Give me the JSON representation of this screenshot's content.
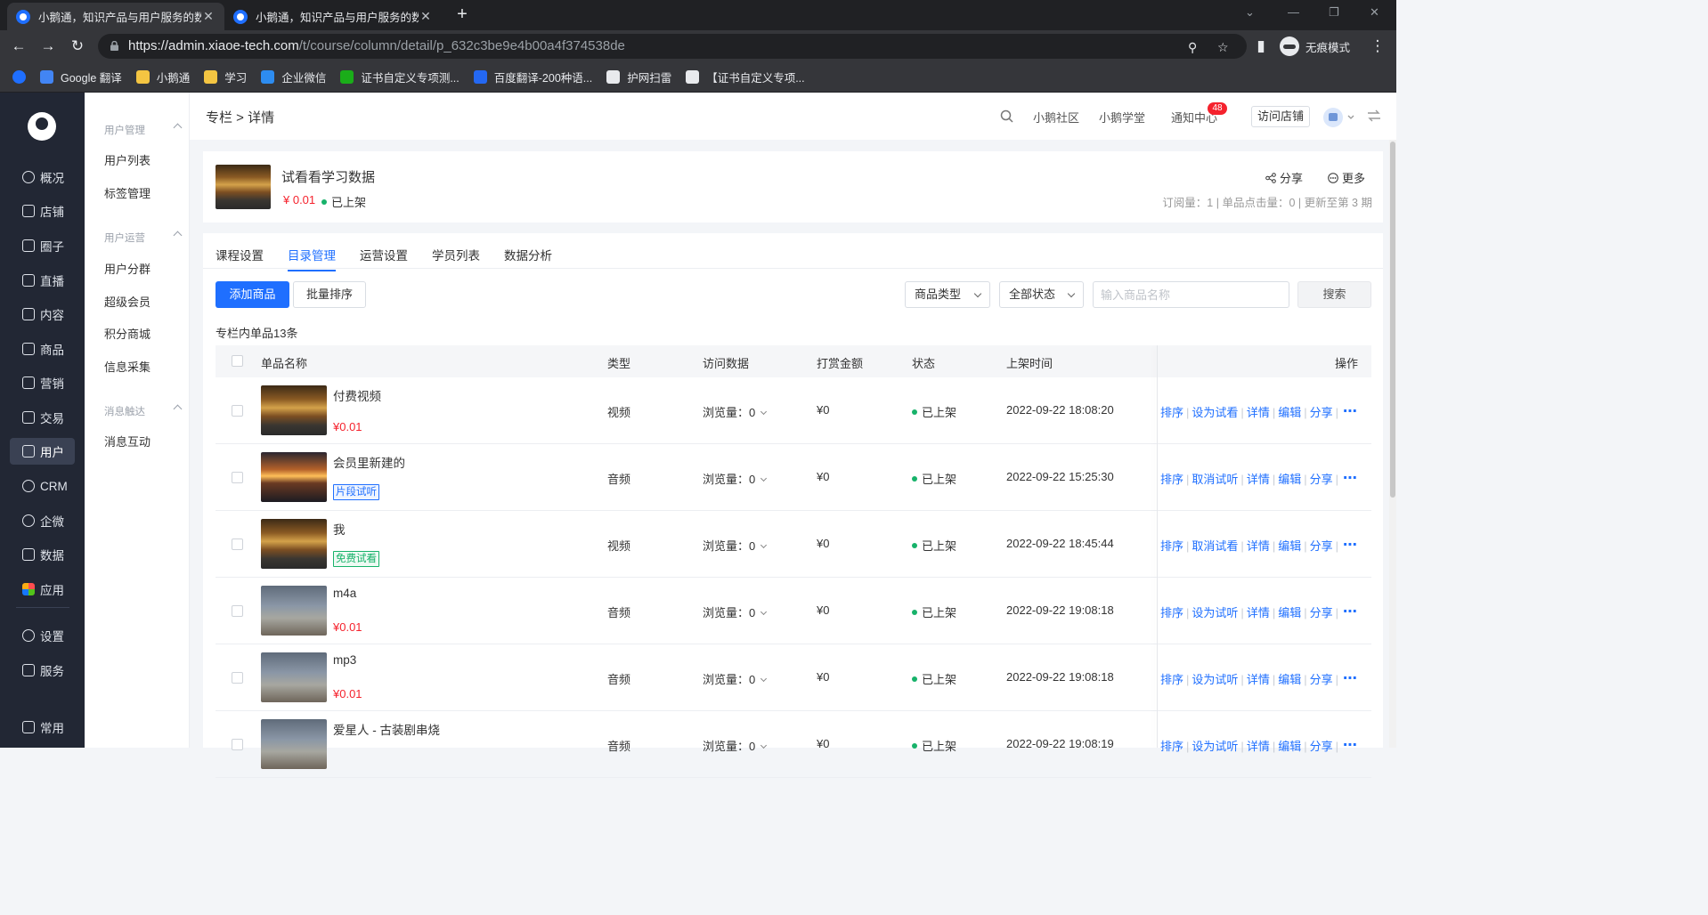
{
  "browser": {
    "tabs": [
      {
        "title": "小鹅通，知识产品与用户服务的数"
      },
      {
        "title": "小鹅通，知识产品与用户服务的数"
      }
    ],
    "url_host": "https://admin.xiaoe-tech.com",
    "url_path": "/t/course/column/detail/p_632c3be9e4b00a4f374538de",
    "incognito_label": "无痕模式",
    "bookmarks": [
      {
        "label": "Google 翻译",
        "color": "#4285f4"
      },
      {
        "label": "小鹅通",
        "color": "#f4c542"
      },
      {
        "label": "学习",
        "color": "#f4c542"
      },
      {
        "label": "企业微信",
        "color": "#2d8cf0"
      },
      {
        "label": "证书自定义专项测...",
        "color": "#1aad19"
      },
      {
        "label": "百度翻译-200种语...",
        "color": "#2468f2"
      },
      {
        "label": "护网扫雷",
        "color": "#e8eaed"
      },
      {
        "label": "【证书自定义专项...",
        "color": "#e8eaed"
      }
    ]
  },
  "nav": {
    "items": [
      {
        "label": "概况"
      },
      {
        "label": "店铺"
      },
      {
        "label": "圈子"
      },
      {
        "label": "直播"
      },
      {
        "label": "内容"
      },
      {
        "label": "商品"
      },
      {
        "label": "营销"
      },
      {
        "label": "交易"
      },
      {
        "label": "用户"
      },
      {
        "label": "CRM"
      },
      {
        "label": "企微"
      },
      {
        "label": "数据"
      },
      {
        "label": "应用"
      },
      {
        "label": "设置"
      },
      {
        "label": "服务"
      },
      {
        "label": "常用"
      }
    ],
    "active": "用户"
  },
  "subnav": {
    "sections": [
      {
        "heading": "用户管理",
        "items": [
          "用户列表",
          "标签管理"
        ]
      },
      {
        "heading": "用户运营",
        "items": [
          "用户分群",
          "超级会员",
          "积分商城",
          "信息采集"
        ]
      },
      {
        "heading": "消息触达",
        "items": [
          "消息互动"
        ]
      }
    ]
  },
  "header": {
    "breadcrumb": "专栏 > 详情",
    "links": [
      "小鹅社区",
      "小鹅学堂",
      "通知中心"
    ],
    "notify_count": "48",
    "visit_store": "访问店铺"
  },
  "column": {
    "title": "试看看学习数据",
    "price": "¥ 0.01",
    "status": "已上架",
    "share": "分享",
    "more": "更多",
    "stats": "订阅量：1  |  单品点击量：0  |  更新至第 3 期"
  },
  "tabs": [
    "课程设置",
    "目录管理",
    "运营设置",
    "学员列表",
    "数据分析"
  ],
  "active_tab": "目录管理",
  "toolbar": {
    "add": "添加商品",
    "batch_sort": "批量排序",
    "type_select": "商品类型",
    "status_select": "全部状态",
    "search_placeholder": "输入商品名称",
    "search": "搜索"
  },
  "count_text": "专栏内单品13条",
  "table": {
    "headers": [
      "单品名称",
      "类型",
      "访问数据",
      "打赏金额",
      "状态",
      "上架时间",
      "操作"
    ],
    "rows": [
      {
        "name": "付费视频",
        "thumb": "autumn",
        "price": "¥0.01",
        "tag": "",
        "tag_color": "",
        "type": "视频",
        "views": "浏览量：0",
        "reward": "¥0",
        "status": "已上架",
        "time": "2022-09-22 18:08:20",
        "trial": "设为试看"
      },
      {
        "name": "会员里新建的",
        "thumb": "sunset",
        "price": "",
        "tag": "片段试听",
        "tag_color": "blue",
        "type": "音频",
        "views": "浏览量：0",
        "reward": "¥0",
        "status": "已上架",
        "time": "2022-09-22 15:25:30",
        "trial": "取消试听"
      },
      {
        "name": "我",
        "thumb": "autumn",
        "price": "",
        "tag": "免费试看",
        "tag_color": "green",
        "type": "视频",
        "views": "浏览量：0",
        "reward": "¥0",
        "status": "已上架",
        "time": "2022-09-22 18:45:44",
        "trial": "取消试看"
      },
      {
        "name": "m4a",
        "thumb": "deer",
        "price": "¥0.01",
        "tag": "",
        "tag_color": "",
        "type": "音频",
        "views": "浏览量：0",
        "reward": "¥0",
        "status": "已上架",
        "time": "2022-09-22 19:08:18",
        "trial": "设为试听"
      },
      {
        "name": "mp3",
        "thumb": "deer",
        "price": "¥0.01",
        "tag": "",
        "tag_color": "",
        "type": "音频",
        "views": "浏览量：0",
        "reward": "¥0",
        "status": "已上架",
        "time": "2022-09-22 19:08:18",
        "trial": "设为试听"
      },
      {
        "name": "爱星人 - 古装剧串烧",
        "thumb": "deer",
        "price": "",
        "tag": "",
        "tag_color": "",
        "type": "音频",
        "views": "浏览量：0",
        "reward": "¥0",
        "status": "已上架",
        "time": "2022-09-22 19:08:19",
        "trial": "设为试听"
      }
    ],
    "ops": [
      "排序",
      "详情",
      "编辑",
      "分享"
    ]
  },
  "colors": {
    "accent": "#1f6fff",
    "price": "#f5222d",
    "online": "#17b26a",
    "sidebar": "#222734"
  }
}
